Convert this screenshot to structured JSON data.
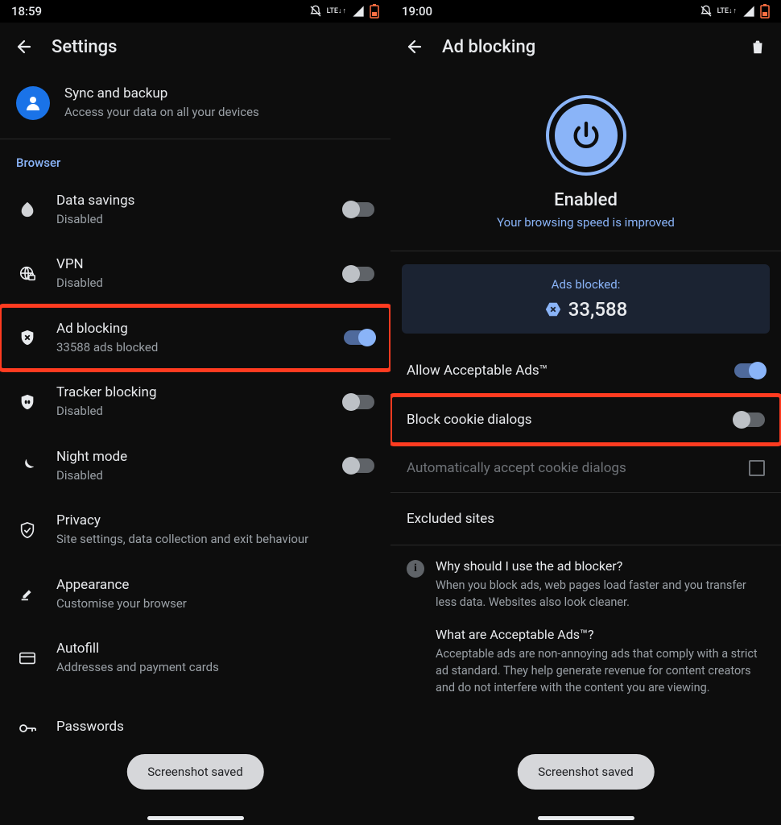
{
  "left": {
    "status": {
      "time": "18:59"
    },
    "header": {
      "title": "Settings"
    },
    "sync": {
      "title": "Sync and backup",
      "subtitle": "Access your data on all your devices"
    },
    "section_label": "Browser",
    "rows": [
      {
        "title": "Data savings",
        "subtitle": "Disabled",
        "on": false
      },
      {
        "title": "VPN",
        "subtitle": "Disabled",
        "on": false
      },
      {
        "title": "Ad blocking",
        "subtitle": "33588 ads blocked",
        "on": true
      },
      {
        "title": "Tracker blocking",
        "subtitle": "Disabled",
        "on": false
      },
      {
        "title": "Night mode",
        "subtitle": "Disabled",
        "on": false
      },
      {
        "title": "Privacy",
        "subtitle": "Site settings, data collection and exit behaviour"
      },
      {
        "title": "Appearance",
        "subtitle": "Customise your browser"
      },
      {
        "title": "Autofill",
        "subtitle": "Addresses and payment cards"
      },
      {
        "title": "Passwords",
        "subtitle": ""
      }
    ],
    "toast": "Screenshot saved"
  },
  "right": {
    "status": {
      "time": "19:00"
    },
    "header": {
      "title": "Ad blocking"
    },
    "hero": {
      "title": "Enabled",
      "subtitle": "Your browsing speed is improved"
    },
    "stat": {
      "label": "Ads blocked:",
      "value": "33,588"
    },
    "opts": {
      "allow_ads": "Allow Acceptable Ads™",
      "block_cookie": "Block cookie dialogs",
      "auto_accept": "Automatically accept cookie dialogs",
      "excluded": "Excluded sites"
    },
    "info": [
      {
        "q": "Why should I use the ad blocker?",
        "a": "When you block ads, web pages load faster and you transfer less data. Websites also look cleaner."
      },
      {
        "q": "What are Acceptable Ads™?",
        "a": "Acceptable ads are non-annoying ads that comply with a strict ad standard. They help generate revenue for content creators and do not interfere with the content you are viewing."
      }
    ],
    "toast": "Screenshot saved"
  }
}
